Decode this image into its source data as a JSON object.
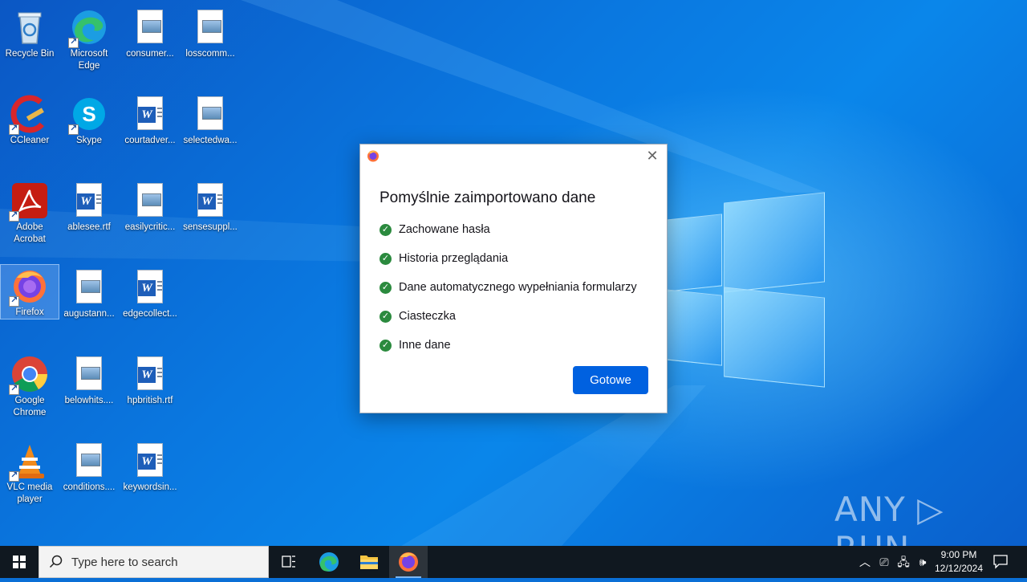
{
  "desktop": {
    "icons": [
      {
        "label": "Recycle Bin"
      },
      {
        "label": "Microsoft Edge"
      },
      {
        "label": "consumer..."
      },
      {
        "label": "losscomm..."
      },
      {
        "label": "CCleaner"
      },
      {
        "label": "Skype"
      },
      {
        "label": "courtadver..."
      },
      {
        "label": "selectedwa..."
      },
      {
        "label": "Adobe Acrobat"
      },
      {
        "label": "ablesee.rtf"
      },
      {
        "label": "easilycritic..."
      },
      {
        "label": "sensesuppl..."
      },
      {
        "label": "Firefox"
      },
      {
        "label": "augustann..."
      },
      {
        "label": "edgecollect..."
      },
      {
        "label": "Google Chrome"
      },
      {
        "label": "belowhits...."
      },
      {
        "label": "hpbritish.rtf"
      },
      {
        "label": "VLC media player"
      },
      {
        "label": "conditions...."
      },
      {
        "label": "keywordsin..."
      }
    ]
  },
  "dialog": {
    "title": "Pomyślnie zaimportowano dane",
    "close_glyph": "✕",
    "items": [
      {
        "label": "Zachowane hasła"
      },
      {
        "label": "Historia przeglądania"
      },
      {
        "label": "Dane automatycznego wypełniania formularzy"
      },
      {
        "label": "Ciasteczka"
      },
      {
        "label": "Inne dane"
      }
    ],
    "done_label": "Gotowe",
    "accent_color": "#0061e0",
    "check_color": "#2b8a3e"
  },
  "watermark": {
    "text": "ANY ▷ RUN"
  },
  "taskbar": {
    "search_placeholder": "Type here to search",
    "clock_time": "9:00 PM",
    "clock_date": "12/12/2024",
    "pinned": [
      {
        "icon": "task-view-icon"
      },
      {
        "icon": "edge-icon"
      },
      {
        "icon": "file-explorer-icon"
      },
      {
        "icon": "firefox-icon",
        "active": true
      }
    ]
  }
}
